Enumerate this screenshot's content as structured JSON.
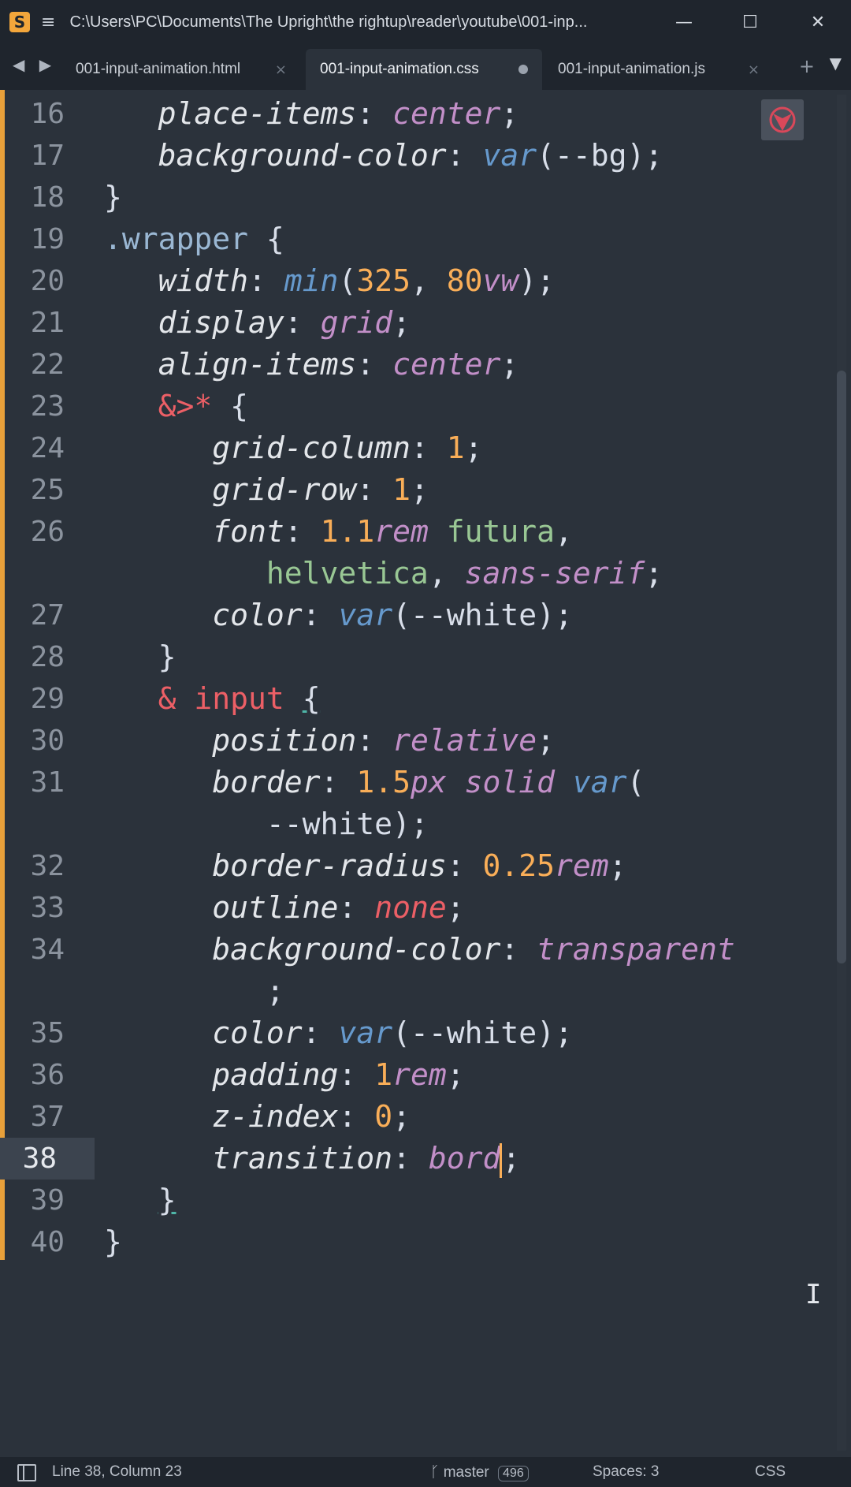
{
  "window": {
    "title": "C:\\Users\\PC\\Documents\\The Upright\\the rightup\\reader\\youtube\\001-inp...",
    "minimize": "—",
    "maximize": "☐",
    "close": "✕"
  },
  "tabs": [
    {
      "label": "001-input-animation.html",
      "state": "close"
    },
    {
      "label": "001-input-animation.css",
      "state": "dirty",
      "active": true
    },
    {
      "label": "001-input-animation.js",
      "state": "close"
    }
  ],
  "tab_close_glyph": "×",
  "tab_add_glyph": "+",
  "tab_menu_glyph": "▼",
  "tab_nav_glyph": "◀ ▶",
  "editor": {
    "line_numbers": [
      "16",
      "17",
      "18",
      "19",
      "20",
      "21",
      "22",
      "23",
      "24",
      "25",
      "26",
      "27",
      "28",
      "29",
      "30",
      "31",
      "32",
      "33",
      "34",
      "35",
      "36",
      "37",
      "38",
      "39",
      "40"
    ],
    "current_line": "38"
  },
  "statusbar": {
    "position": "Line 38, Column 23",
    "branch": "master",
    "branch_count": "496",
    "indent": "Spaces: 3",
    "syntax": "CSS"
  },
  "colors": {
    "background": "#2b323b",
    "chrome": "#1f252d",
    "modified_marker": "#e8a03a",
    "cursor": "#f9ae58"
  }
}
